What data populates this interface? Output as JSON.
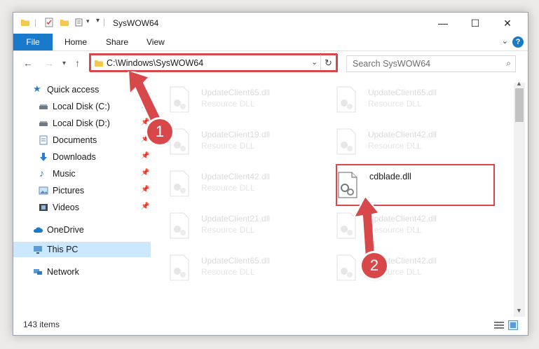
{
  "window": {
    "title": "SysWOW64",
    "minimize_glyph": "—",
    "maximize_glyph": "☐",
    "close_glyph": "✕"
  },
  "ribbon": {
    "tabs": [
      "File",
      "Home",
      "Share",
      "View"
    ],
    "help_glyph": "?"
  },
  "address": {
    "path": "C:\\Windows\\SysWOW64",
    "search_placeholder": "Search SysWOW64"
  },
  "nav": {
    "items": [
      {
        "label": "Quick access",
        "icon": "star-icon"
      },
      {
        "label": "Local Disk (C:)",
        "icon": "drive-icon",
        "pinned": true
      },
      {
        "label": "Local Disk (D:)",
        "icon": "drive-icon",
        "pinned": true
      },
      {
        "label": "Documents",
        "icon": "documents-icon",
        "pinned": true
      },
      {
        "label": "Downloads",
        "icon": "download-icon",
        "pinned": true
      },
      {
        "label": "Music",
        "icon": "music-icon",
        "pinned": true
      },
      {
        "label": "Pictures",
        "icon": "pictures-icon",
        "pinned": true
      },
      {
        "label": "Videos",
        "icon": "videos-icon",
        "pinned": true
      },
      {
        "label": "OneDrive",
        "icon": "cloud-icon"
      },
      {
        "label": "This PC",
        "icon": "computer-icon",
        "selected": true
      },
      {
        "label": "Network",
        "icon": "network-icon"
      }
    ]
  },
  "files": [
    {
      "name": "UpdateClient65.dll",
      "type": "Resource DLL"
    },
    {
      "name": "UpdateClient65.dll",
      "type": "Resource DLL"
    },
    {
      "name": "UpdateClient19.dll",
      "type": "Resource DLL"
    },
    {
      "name": "UpdateClient42.dll",
      "type": "Resource DLL"
    },
    {
      "name": "UpdateClient42.dll",
      "type": "Resource DLL"
    },
    {
      "name": "cdblade.dll",
      "type": ""
    },
    {
      "name": "UpdateClient21.dll",
      "type": "Resource DLL"
    },
    {
      "name": "UpdateClient42.dll",
      "type": "Resource DLL"
    },
    {
      "name": "UpdateClient65.dll",
      "type": "Resource DLL"
    },
    {
      "name": "UpdateClient42.dll",
      "type": "Resource DLL"
    }
  ],
  "status": {
    "item_count": "143 items"
  },
  "annotations": {
    "step1": "1",
    "step2": "2"
  },
  "colors": {
    "accent": "#1979ca",
    "highlight": "#d8484b"
  }
}
